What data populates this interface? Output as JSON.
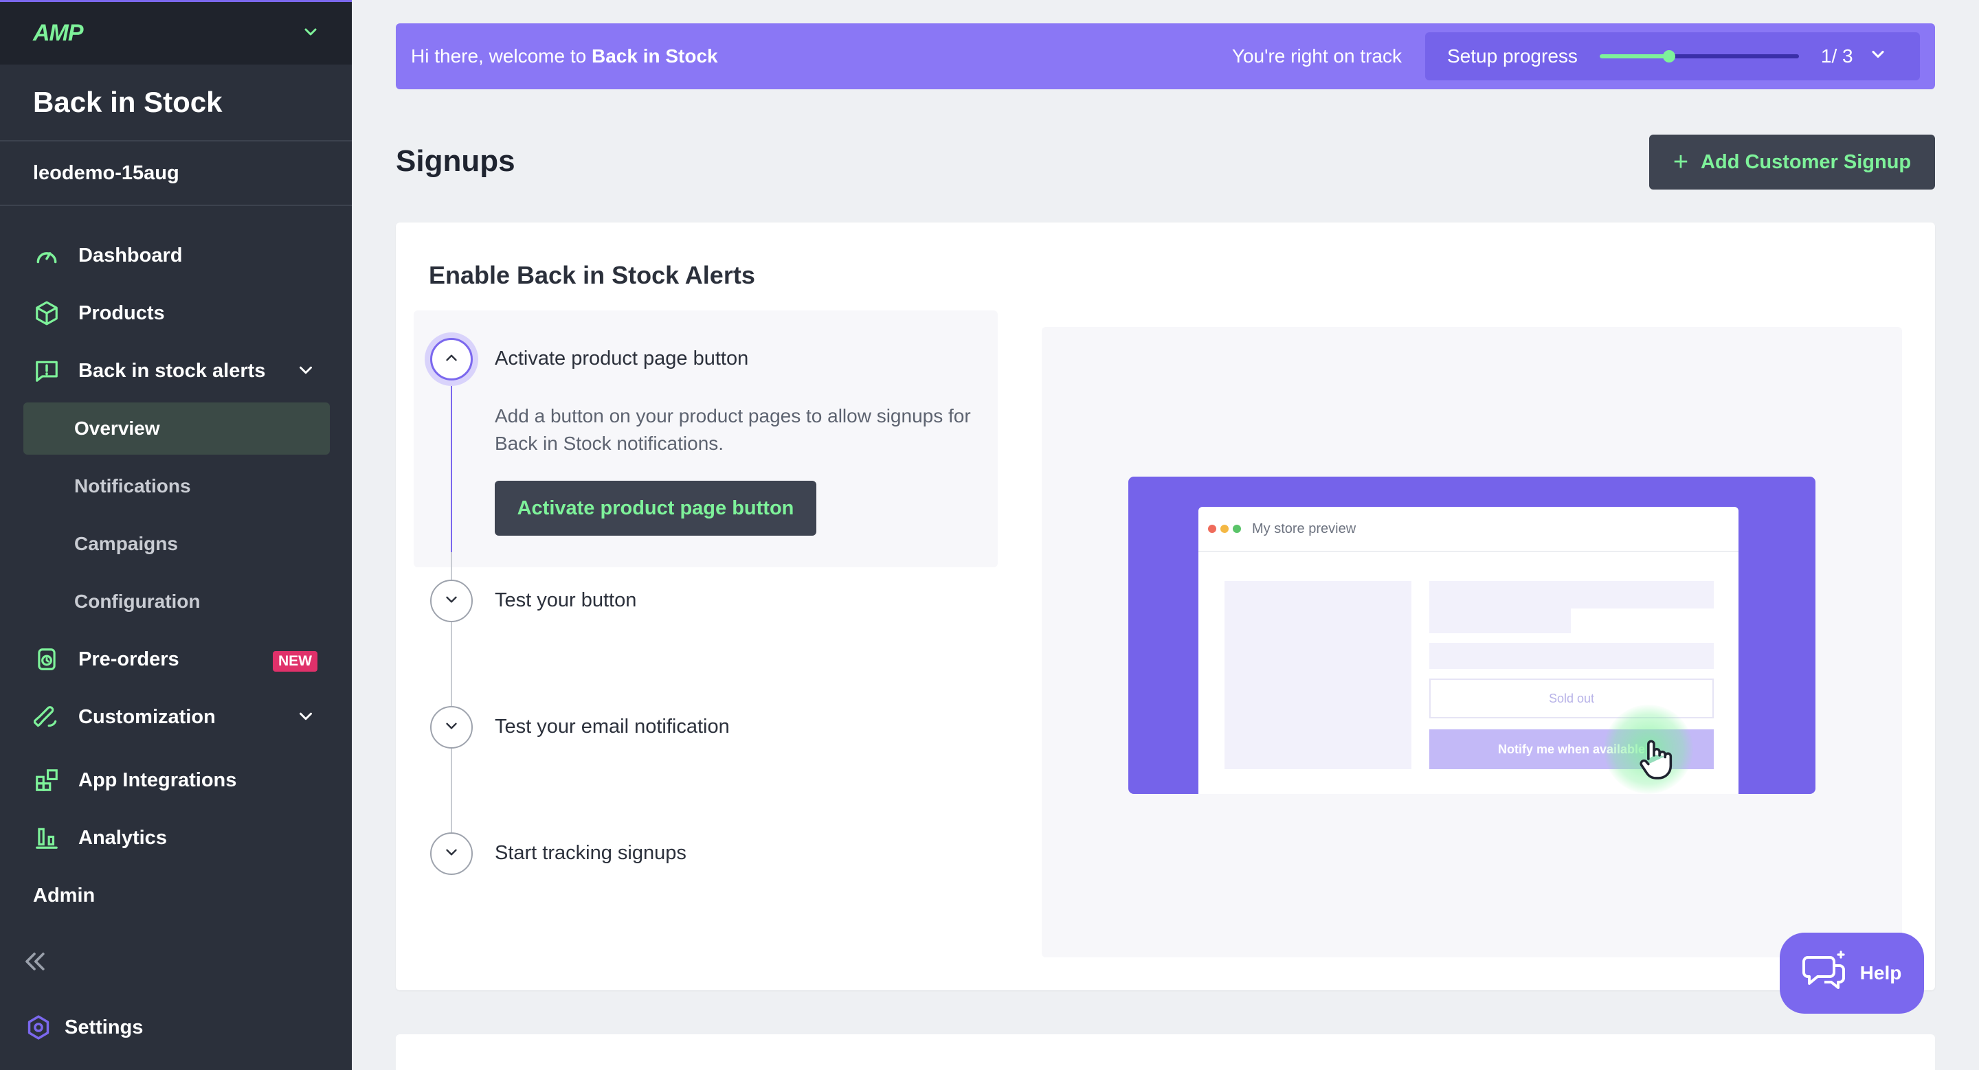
{
  "sidebar": {
    "logo": "AMP",
    "app_title": "Back in Stock",
    "store_name": "leodemo-15aug",
    "items": [
      {
        "label": "Dashboard"
      },
      {
        "label": "Products"
      },
      {
        "label": "Back in stock alerts"
      },
      {
        "label": "Pre-orders",
        "badge": "NEW"
      },
      {
        "label": "Customization"
      },
      {
        "label": "App Integrations"
      },
      {
        "label": "Analytics"
      }
    ],
    "subitems": [
      {
        "label": "Overview"
      },
      {
        "label": "Notifications"
      },
      {
        "label": "Campaigns"
      },
      {
        "label": "Configuration"
      }
    ],
    "admin_label": "Admin",
    "settings_label": "Settings"
  },
  "banner": {
    "welcome_prefix": "Hi there, welcome to ",
    "welcome_app": "Back in Stock",
    "track_text": "You're right on track",
    "progress_label": "Setup progress",
    "progress_count": "1/ 3",
    "progress_fraction": 0.35
  },
  "page": {
    "title": "Signups",
    "add_button": "Add Customer Signup"
  },
  "card": {
    "title": "Enable Back in Stock Alerts",
    "steps": [
      {
        "label": "Activate product page button"
      },
      {
        "label": "Test your button"
      },
      {
        "label": "Test your email notification"
      },
      {
        "label": "Start tracking signups"
      }
    ],
    "active_desc": "Add a button on your product pages to allow signups for Back in Stock notifications.",
    "active_button": "Activate product page button"
  },
  "preview": {
    "window_title": "My store preview",
    "sold_out": "Sold out",
    "notify": "Notify me when available"
  },
  "help": {
    "label": "Help"
  },
  "colors": {
    "accent": "#7b68ee",
    "brand_green": "#7ef29a",
    "sidebar_bg": "#2b303b",
    "badge": "#e0316a"
  }
}
